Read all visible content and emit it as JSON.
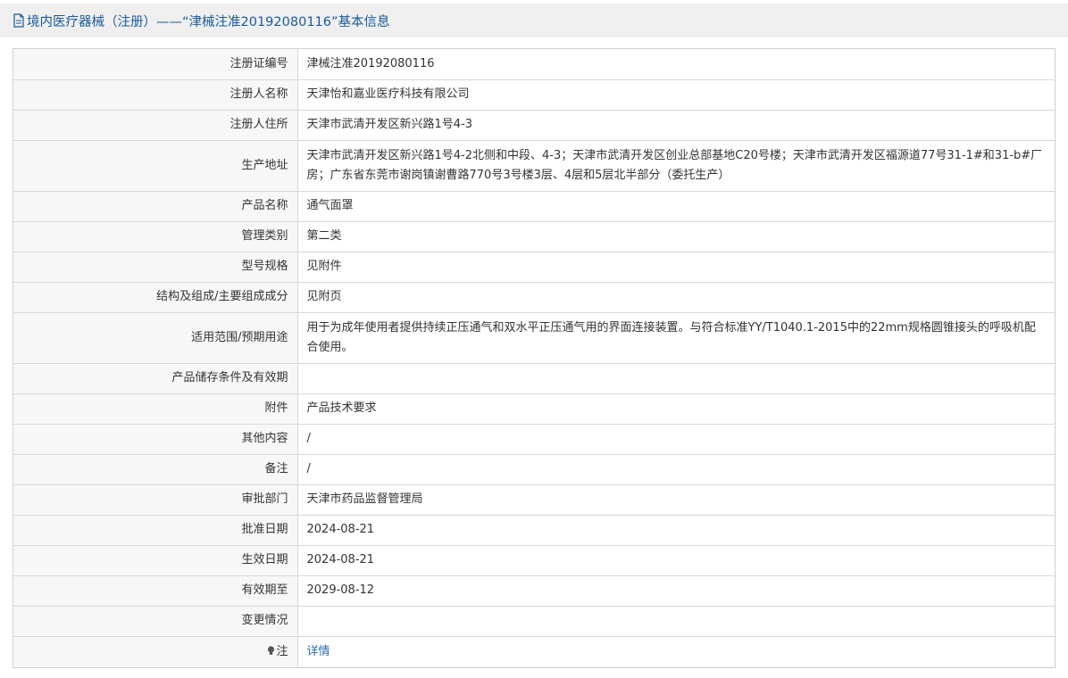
{
  "header": {
    "title": "境内医疗器械（注册）——“津械注准20192080116”基本信息",
    "icon": "document-icon"
  },
  "colors": {
    "header_bg": "#efefef",
    "title": "#1a5a9a",
    "label_bg": "#f7f7f7",
    "link": "#2b6cb0",
    "border": "#d8d8d8"
  },
  "rows": [
    {
      "label": "注册证编号",
      "value": "津械注准20192080116"
    },
    {
      "label": "注册人名称",
      "value": "天津怡和嘉业医疗科技有限公司"
    },
    {
      "label": "注册人住所",
      "value": "天津市武清开发区新兴路1号4-3"
    },
    {
      "label": "生产地址",
      "value": "天津市武清开发区新兴路1号4-2北侧和中段、4-3；天津市武清开发区创业总部基地C20号楼；天津市武清开发区福源道77号31-1#和31-b#厂房；广东省东莞市谢岗镇谢曹路770号3号楼3层、4层和5层北半部分（委托生产）"
    },
    {
      "label": "产品名称",
      "value": "通气面罩"
    },
    {
      "label": "管理类别",
      "value": "第二类"
    },
    {
      "label": "型号规格",
      "value": "见附件"
    },
    {
      "label": "结构及组成/主要组成成分",
      "value": "见附页"
    },
    {
      "label": "适用范围/预期用途",
      "value": "用于为成年使用者提供持续正压通气和双水平正压通气用的界面连接装置。与符合标准YY/T1040.1-2015中的22mm规格圆锥接头的呼吸机配合使用。"
    },
    {
      "label": "产品储存条件及有效期",
      "value": ""
    },
    {
      "label": "附件",
      "value": "产品技术要求"
    },
    {
      "label": "其他内容",
      "value": "/"
    },
    {
      "label": "备注",
      "value": "/"
    },
    {
      "label": "审批部门",
      "value": "天津市药品监督管理局"
    },
    {
      "label": "批准日期",
      "value": "2024-08-21"
    },
    {
      "label": "生效日期",
      "value": "2024-08-21"
    },
    {
      "label": "有效期至",
      "value": "2029-08-12"
    },
    {
      "label": "变更情况",
      "value": ""
    },
    {
      "label": "注",
      "value": "详情",
      "icon": "lightbulb-icon"
    }
  ]
}
